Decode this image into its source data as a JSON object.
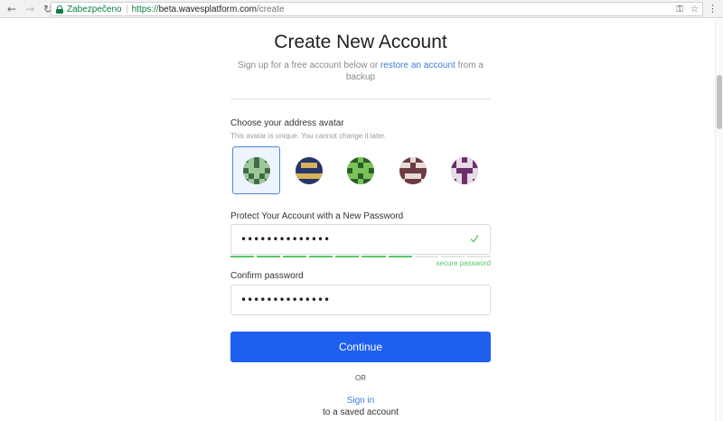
{
  "browser": {
    "secure_label": "Zabezpečeno",
    "url_scheme": "https://",
    "url_host": "beta.wavesplatform.com",
    "url_path": "/create"
  },
  "page": {
    "title": "Create New Account",
    "subtitle_prefix": "Sign up for a free account below or ",
    "subtitle_link": "restore an account",
    "subtitle_suffix": " from a backup"
  },
  "avatar_section": {
    "label": "Choose your address avatar",
    "hint": "This avatar is unique. You cannot change it later.",
    "selected_index": 0,
    "avatars": [
      {
        "bg": "#3f6b45",
        "fg": "#9fc89a",
        "pattern": [
          [
            0,
            1,
            0,
            1,
            0
          ],
          [
            1,
            1,
            0,
            1,
            1
          ],
          [
            0,
            1,
            1,
            1,
            0
          ],
          [
            1,
            0,
            1,
            0,
            1
          ],
          [
            0,
            1,
            0,
            1,
            0
          ]
        ]
      },
      {
        "bg": "#26366b",
        "fg": "#d7b45a",
        "pattern": [
          [
            0,
            0,
            0,
            0,
            0
          ],
          [
            0,
            1,
            1,
            1,
            0
          ],
          [
            0,
            0,
            0,
            0,
            0
          ],
          [
            1,
            1,
            1,
            1,
            1
          ],
          [
            0,
            0,
            0,
            0,
            0
          ]
        ]
      },
      {
        "bg": "#2f5b2a",
        "fg": "#79c457",
        "pattern": [
          [
            0,
            0,
            1,
            0,
            0
          ],
          [
            1,
            1,
            0,
            1,
            1
          ],
          [
            0,
            1,
            1,
            1,
            0
          ],
          [
            1,
            1,
            0,
            1,
            1
          ],
          [
            0,
            0,
            1,
            0,
            0
          ]
        ]
      },
      {
        "bg": "#6b3c46",
        "fg": "#e8dcd2",
        "pattern": [
          [
            0,
            0,
            1,
            0,
            0
          ],
          [
            1,
            1,
            0,
            1,
            1
          ],
          [
            0,
            0,
            0,
            0,
            0
          ],
          [
            0,
            1,
            1,
            1,
            0
          ],
          [
            1,
            0,
            0,
            0,
            1
          ]
        ]
      },
      {
        "bg": "#6b2f6b",
        "fg": "#e7dbe8",
        "pattern": [
          [
            0,
            1,
            0,
            1,
            0
          ],
          [
            0,
            1,
            1,
            1,
            0
          ],
          [
            1,
            0,
            0,
            0,
            1
          ],
          [
            1,
            1,
            0,
            1,
            1
          ],
          [
            0,
            1,
            0,
            1,
            0
          ]
        ]
      }
    ]
  },
  "password": {
    "label": "Protect Your Account with a New Password",
    "value": "••••••••••••••",
    "strength_segments": 10,
    "strength_filled": 7,
    "strength_label": "secure password",
    "strength_color": "#5cc66a"
  },
  "confirm": {
    "label": "Confirm password",
    "value": "••••••••••••••"
  },
  "actions": {
    "continue_label": "Continue",
    "or_label": "OR",
    "signin_label": "Sign in",
    "signin_suffix": "to a saved account"
  },
  "colors": {
    "primary": "#1f5ff0",
    "link": "#3d7bd9",
    "success": "#5cc66a"
  }
}
